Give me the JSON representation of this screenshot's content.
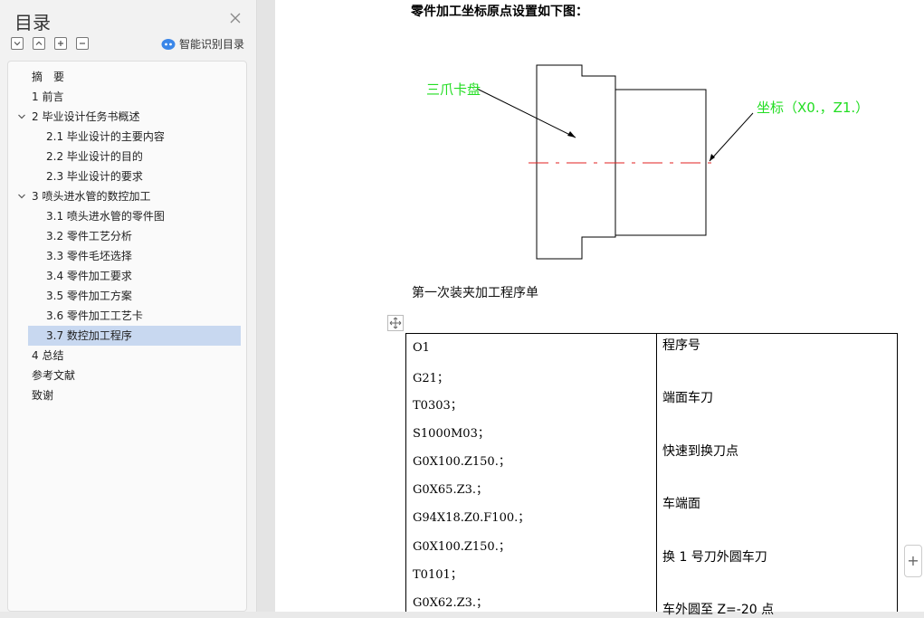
{
  "sidebar": {
    "title": "目录",
    "smart_toc_label": "智能识别目录",
    "items": [
      {
        "label": "摘　要"
      },
      {
        "label": "1 前言"
      },
      {
        "label": "2  毕业设计任务书概述"
      },
      {
        "label": "2.1    毕业设计的主要内容"
      },
      {
        "label": "2.2    毕业设计的目的"
      },
      {
        "label": "2.3    毕业设计的要求"
      },
      {
        "label": "3  喷头进水管的数控加工"
      },
      {
        "label": "3.1    喷头进水管的零件图"
      },
      {
        "label": "3.2    零件工艺分析"
      },
      {
        "label": "3.3    零件毛坯选择"
      },
      {
        "label": "3.4    零件加工要求"
      },
      {
        "label": "3.5    零件加工方案"
      },
      {
        "label": "3.6    零件加工工艺卡"
      },
      {
        "label": "3.7    数控加工程序"
      },
      {
        "label": "4 总结"
      },
      {
        "label": "参考文献"
      },
      {
        "label": "致谢"
      }
    ]
  },
  "document": {
    "heading": "零件加工坐标原点设置如下图：",
    "drawing": {
      "chuck_label": "三爪卡盘",
      "coord_label": "坐标（X0.，Z1.）",
      "label_color": "#22dd22",
      "centerline_color": "#e02020"
    },
    "caption": "第一次装夹加工程序单",
    "table": {
      "code_lines": [
        "O1",
        "G21；",
        "T0303；",
        "S1000M03；",
        "G0X100.Z150.；",
        "G0X65.Z3.；",
        "G94X18.Z0.F100.；",
        "G0X100.Z150.；",
        "T0101；",
        "G0X62.Z3.；"
      ],
      "notes": [
        "程序号",
        "端面车刀",
        "快速到换刀点",
        "车端面",
        "换 1 号刀外圆车刀",
        "车外圆至 Z=-20 点"
      ]
    }
  },
  "add_button_label": "+"
}
